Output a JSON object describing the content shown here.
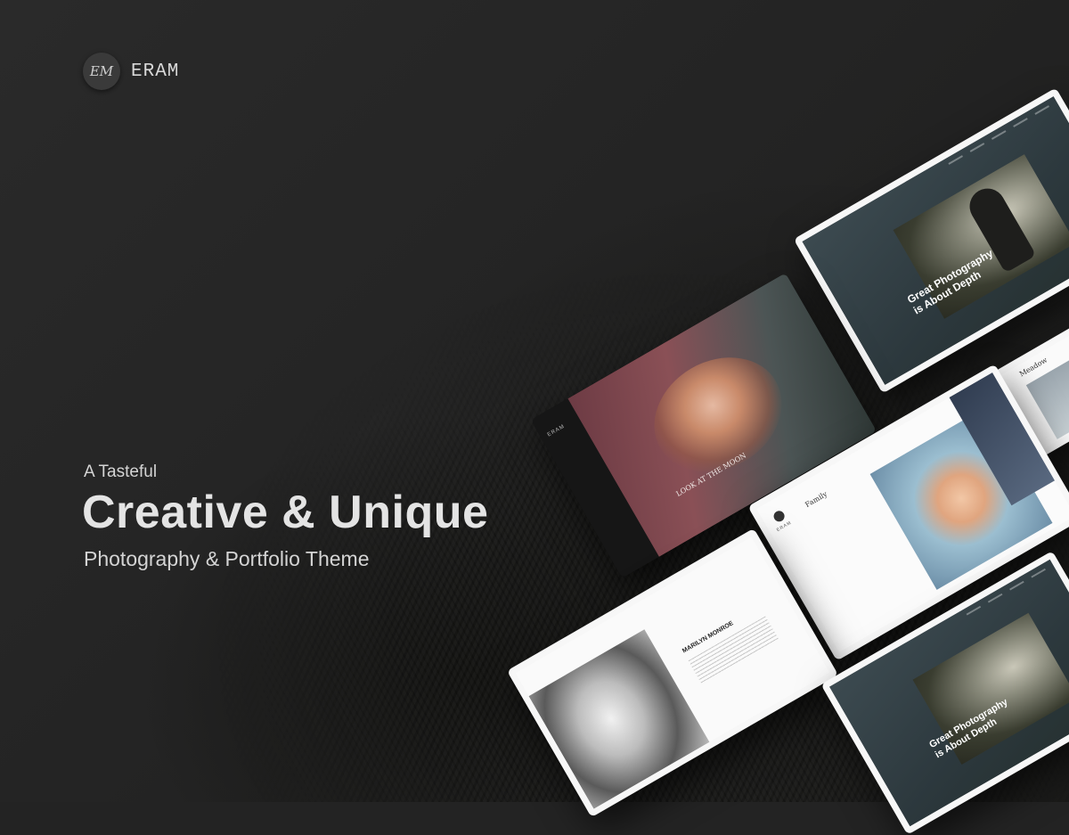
{
  "logo": {
    "initials": "EM",
    "name": "ERAM"
  },
  "hero": {
    "pre": "A Tasteful",
    "headline": "Creative & Unique",
    "subline": "Photography & Portfolio Theme"
  },
  "mockups": {
    "depth_top": {
      "caption_line1": "Great Photography",
      "caption_line2": "is About Depth"
    },
    "moon": {
      "brand": "ERAM",
      "caption": "LOOK AT THE MOON"
    },
    "family": {
      "brand": "ERAM",
      "title": "Family"
    },
    "monroe": {
      "caption": "MARILYN MONROE"
    },
    "depth_bottom": {
      "caption_line1": "Great Photography",
      "caption_line2": "is About Depth"
    },
    "magazine": {
      "title": "Meadow"
    }
  },
  "colors": {
    "background": "#232323",
    "text": "#e4e4e4"
  }
}
